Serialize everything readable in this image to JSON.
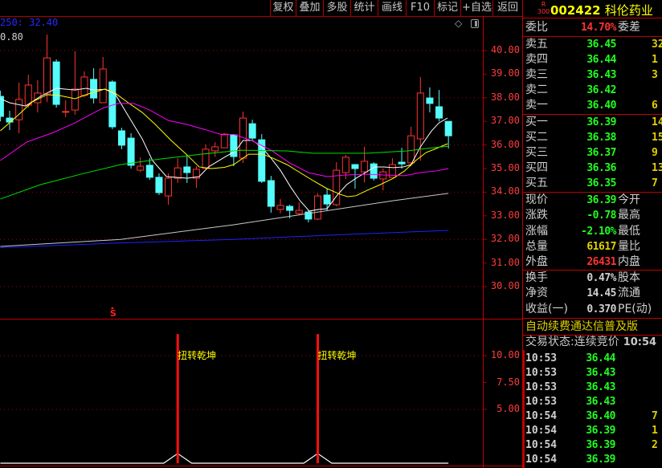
{
  "toolbar": {
    "buttons": [
      "复权",
      "叠加",
      "多股",
      "统计",
      "画线",
      "F10",
      "标记",
      "+自选",
      "返回"
    ]
  },
  "chart_header": {
    "ma_label": "250: 32.40",
    "top_value": "0.80",
    "icons": [
      "diamond-icon",
      "panel-toggle-icon"
    ]
  },
  "colors": {
    "up": "#ff3232",
    "down": "#54fcfc",
    "ma5": "#ffffff",
    "ma10": "#ffff00",
    "ma20": "#ff00ff",
    "ma30": "#00e000",
    "ma60": "#c8c8c8",
    "ma120": "#2020ff",
    "grid": "#a00000",
    "axis_text": "#ff3c3c"
  },
  "chart_data": [
    {
      "type": "candlestick",
      "ylim": [
        30,
        40
      ],
      "y_ticks": [
        "40.00",
        "39.00",
        "38.00",
        "37.00",
        "36.00",
        "35.00",
        "34.00",
        "33.00",
        "32.00",
        "31.00",
        "30.00"
      ],
      "candles": [
        [
          38.06,
          38.3,
          37.0,
          37.21
        ],
        [
          37.14,
          37.45,
          36.63,
          36.97
        ],
        [
          37.07,
          38.64,
          36.5,
          37.93
        ],
        [
          37.69,
          38.98,
          37.58,
          38.54
        ],
        [
          37.79,
          38.74,
          37.38,
          38.2
        ],
        [
          38.16,
          40.68,
          37.82,
          39.69
        ],
        [
          39.52,
          39.63,
          37.58,
          37.72
        ],
        [
          37.4,
          37.89,
          37.18,
          37.42
        ],
        [
          37.48,
          39.97,
          37.28,
          38.37
        ],
        [
          38.1,
          39.12,
          38.03,
          38.88
        ],
        [
          38.78,
          39.25,
          37.76,
          37.99
        ],
        [
          37.79,
          39.73,
          37.79,
          39.22
        ],
        [
          38.67,
          38.74,
          36.67,
          36.77
        ],
        [
          36.6,
          36.73,
          35.82,
          35.99
        ],
        [
          36.29,
          36.5,
          35.0,
          35.14
        ],
        [
          34.93,
          35.48,
          34.86,
          35.1
        ],
        [
          35.14,
          35.44,
          34.52,
          34.63
        ],
        [
          34.63,
          34.8,
          33.88,
          33.98
        ],
        [
          33.84,
          34.8,
          33.47,
          34.59
        ],
        [
          34.59,
          35.44,
          34.39,
          35.03
        ],
        [
          35.07,
          35.58,
          34.39,
          34.83
        ],
        [
          34.59,
          35.1,
          34.18,
          34.97
        ],
        [
          35.0,
          36.02,
          35.0,
          35.82
        ],
        [
          35.75,
          36.12,
          35.5,
          35.92
        ],
        [
          35.88,
          36.5,
          35.88,
          36.46
        ],
        [
          36.43,
          36.46,
          35.1,
          35.51
        ],
        [
          35.44,
          37.41,
          35.24,
          37.14
        ],
        [
          36.9,
          37.07,
          36.22,
          36.29
        ],
        [
          36.22,
          36.46,
          34.39,
          34.46
        ],
        [
          34.49,
          34.69,
          33.13,
          33.4
        ],
        [
          33.27,
          33.71,
          33.1,
          33.44
        ],
        [
          33.4,
          33.47,
          32.89,
          33.23
        ],
        [
          33.1,
          33.57,
          33.03,
          33.23
        ],
        [
          33.16,
          33.23,
          32.72,
          32.86
        ],
        [
          32.86,
          33.95,
          32.82,
          33.84
        ],
        [
          33.88,
          34.15,
          33.2,
          33.5
        ],
        [
          33.47,
          35.27,
          33.4,
          34.93
        ],
        [
          34.83,
          35.58,
          34.56,
          35.48
        ],
        [
          35.17,
          35.17,
          34.15,
          35.0
        ],
        [
          34.86,
          35.92,
          34.42,
          35.31
        ],
        [
          35.2,
          35.27,
          34.49,
          34.59
        ],
        [
          34.56,
          35.0,
          34.08,
          34.86
        ],
        [
          34.63,
          35.44,
          34.63,
          35.17
        ],
        [
          35.27,
          35.88,
          35.0,
          35.2
        ],
        [
          35.24,
          36.77,
          35.1,
          36.39
        ],
        [
          36.26,
          38.88,
          35.34,
          38.2
        ],
        [
          37.99,
          38.44,
          37.38,
          37.76
        ],
        [
          37.62,
          38.33,
          37.0,
          37.14
        ],
        [
          37.0,
          37.0,
          35.85,
          36.39
        ]
      ],
      "ma_lines": [
        {
          "name": "ma5",
          "points": [
            [
              0,
              37.96
            ],
            [
              1,
              37.79
            ],
            [
              2.7,
              37.65
            ],
            [
              4.3,
              38.06
            ],
            [
              6,
              38.4
            ],
            [
              8,
              38.33
            ],
            [
              9.2,
              38.4
            ],
            [
              10,
              38.33
            ],
            [
              11.2,
              38.36
            ],
            [
              12.3,
              38.16
            ],
            [
              14,
              37.04
            ],
            [
              15.2,
              36.26
            ],
            [
              16.3,
              35.34
            ],
            [
              17.8,
              34.66
            ],
            [
              20,
              34.59
            ],
            [
              21.3,
              34.66
            ],
            [
              22.3,
              35.07
            ],
            [
              24,
              35.48
            ],
            [
              25.2,
              35.75
            ],
            [
              26,
              36.19
            ],
            [
              27,
              36.19
            ],
            [
              28,
              35.92
            ],
            [
              29,
              35.44
            ],
            [
              30,
              34.93
            ],
            [
              31.1,
              34.22
            ],
            [
              32.1,
              33.64
            ],
            [
              33.1,
              33.2
            ],
            [
              34.1,
              33.27
            ],
            [
              35,
              33.3
            ],
            [
              36.1,
              33.88
            ],
            [
              37.1,
              34.32
            ],
            [
              38.1,
              34.59
            ],
            [
              39.1,
              34.83
            ],
            [
              40.1,
              35.07
            ],
            [
              41.1,
              35.07
            ],
            [
              42.1,
              35.04
            ],
            [
              43.2,
              35.07
            ],
            [
              44,
              35.17
            ],
            [
              45,
              35.92
            ],
            [
              46.2,
              36.6
            ],
            [
              47,
              36.94
            ],
            [
              47.9,
              37.14
            ]
          ]
        },
        {
          "name": "ma10",
          "points": [
            [
              0,
              36.6
            ],
            [
              1.95,
              37.28
            ],
            [
              3.4,
              37.82
            ],
            [
              5,
              38.13
            ],
            [
              6.3,
              38.1
            ],
            [
              8,
              37.96
            ],
            [
              9.4,
              38.16
            ],
            [
              11.2,
              38.37
            ],
            [
              12.3,
              38.2
            ],
            [
              13.7,
              37.79
            ],
            [
              15.2,
              37.38
            ],
            [
              16.6,
              36.87
            ],
            [
              18.3,
              36.19
            ],
            [
              20,
              35.58
            ],
            [
              21.3,
              35.07
            ],
            [
              22.6,
              35.0
            ],
            [
              24,
              35.05
            ],
            [
              25,
              35.17
            ],
            [
              26.6,
              35.61
            ],
            [
              28.1,
              35.61
            ],
            [
              29.2,
              35.44
            ],
            [
              30.7,
              35.17
            ],
            [
              32.1,
              34.83
            ],
            [
              33.5,
              34.49
            ],
            [
              35,
              34.15
            ],
            [
              36.4,
              33.91
            ],
            [
              37.2,
              33.81
            ],
            [
              38.1,
              33.85
            ],
            [
              39.3,
              34.08
            ],
            [
              40.7,
              34.32
            ],
            [
              42.1,
              34.59
            ],
            [
              43.3,
              34.9
            ],
            [
              44.5,
              35.34
            ],
            [
              45.6,
              35.68
            ],
            [
              46.7,
              35.85
            ],
            [
              47.9,
              36.05
            ]
          ]
        },
        {
          "name": "ma20",
          "points": [
            [
              0,
              35.34
            ],
            [
              2.8,
              36.12
            ],
            [
              5.7,
              36.53
            ],
            [
              8,
              36.94
            ],
            [
              10.9,
              37.55
            ],
            [
              12.6,
              37.76
            ],
            [
              14.3,
              37.76
            ],
            [
              16,
              37.48
            ],
            [
              18,
              37.04
            ],
            [
              20,
              36.87
            ],
            [
              22.1,
              36.63
            ],
            [
              23.8,
              36.43
            ],
            [
              25,
              36.45
            ],
            [
              26.9,
              36.19
            ],
            [
              29,
              35.78
            ],
            [
              31,
              35.24
            ],
            [
              33,
              34.83
            ],
            [
              35,
              34.66
            ],
            [
              37,
              34.73
            ],
            [
              39.3,
              34.76
            ],
            [
              41,
              34.73
            ],
            [
              43.3,
              34.7
            ],
            [
              45,
              34.83
            ],
            [
              46.7,
              34.9
            ],
            [
              48,
              35.0
            ]
          ]
        },
        {
          "name": "ma30",
          "points": [
            [
              0,
              33.71
            ],
            [
              4.3,
              34.32
            ],
            [
              8.6,
              34.76
            ],
            [
              12.9,
              35.17
            ],
            [
              17.2,
              35.41
            ],
            [
              21.5,
              35.61
            ],
            [
              25.8,
              35.78
            ],
            [
              30.7,
              35.75
            ],
            [
              33.5,
              35.65
            ],
            [
              39.3,
              35.65
            ],
            [
              43.6,
              35.75
            ],
            [
              45.6,
              35.85
            ],
            [
              48,
              35.95
            ]
          ]
        },
        {
          "name": "ma60",
          "points": [
            [
              0,
              31.7
            ],
            [
              12.9,
              32.0
            ],
            [
              25,
              32.62
            ],
            [
              30.7,
              32.96
            ],
            [
              36.4,
              33.3
            ],
            [
              42.1,
              33.64
            ],
            [
              48,
              33.95
            ]
          ]
        },
        {
          "name": "ma120",
          "points": [
            [
              0,
              31.65
            ],
            [
              12.9,
              31.85
            ],
            [
              25,
              32.0
            ],
            [
              36.4,
              32.2
            ],
            [
              48,
              32.38
            ]
          ]
        }
      ],
      "markers": [
        {
          "index": 12,
          "label": "S"
        }
      ]
    },
    {
      "type": "bar",
      "ylim": [
        0,
        13.5
      ],
      "y_ticks": [
        "10.00",
        "7.50",
        "5.00"
      ],
      "signals": [
        {
          "index": 19,
          "value": 12,
          "label": "扭转乾坤"
        },
        {
          "index": 34,
          "value": 12,
          "label": "扭转乾坤"
        }
      ],
      "baseline_value": 0,
      "bump_value": 0.9
    }
  ],
  "stock": {
    "badge_top": "R",
    "badge_bottom": "300",
    "code": "002422",
    "name": "科伦药业"
  },
  "weibi": {
    "label": "委比",
    "value": "14.70%",
    "label2": "委差"
  },
  "sell": [
    {
      "label": "卖五",
      "price": "36.45",
      "vol": "32"
    },
    {
      "label": "卖四",
      "price": "36.44",
      "vol": "1"
    },
    {
      "label": "卖三",
      "price": "36.43",
      "vol": "3"
    },
    {
      "label": "卖二",
      "price": "36.42",
      "vol": ""
    },
    {
      "label": "卖一",
      "price": "36.40",
      "vol": "6"
    }
  ],
  "buy": [
    {
      "label": "买一",
      "price": "36.39",
      "vol": "14"
    },
    {
      "label": "买二",
      "price": "36.38",
      "vol": "15"
    },
    {
      "label": "买三",
      "price": "36.37",
      "vol": "9"
    },
    {
      "label": "买四",
      "price": "36.36",
      "vol": "13"
    },
    {
      "label": "买五",
      "price": "36.35",
      "vol": "7"
    }
  ],
  "quote": [
    {
      "label": "现价",
      "value": "36.39",
      "label2": "今开",
      "color": "#20ff20"
    },
    {
      "label": "涨跌",
      "value": "-0.78",
      "label2": "最高",
      "color": "#20ff20"
    },
    {
      "label": "涨幅",
      "value": "-2.10%",
      "label2": "最低",
      "color": "#20ff20"
    },
    {
      "label": "总量",
      "value": "61617",
      "label2": "量比",
      "color": "#e0d000"
    },
    {
      "label": "外盘",
      "value": "26431",
      "label2": "内盘",
      "color": "#ff3232"
    }
  ],
  "fundamentals": [
    {
      "label": "换手",
      "value": "0.47%",
      "label2": "股本"
    },
    {
      "label": "净资",
      "value": "14.45",
      "label2": "流通"
    },
    {
      "label": "收益(一)",
      "value": "0.370",
      "label2": "PE(动)"
    }
  ],
  "banner": "自动续费通达信普及版",
  "status": {
    "label": "交易状态:",
    "value": "连续竞价",
    "time": "10:54"
  },
  "ticks": [
    {
      "time": "10:53",
      "price": "36.44",
      "vol": ""
    },
    {
      "time": "10:53",
      "price": "36.43",
      "vol": ""
    },
    {
      "time": "10:53",
      "price": "36.43",
      "vol": ""
    },
    {
      "time": "10:53",
      "price": "36.43",
      "vol": ""
    },
    {
      "time": "10:54",
      "price": "36.40",
      "vol": "7"
    },
    {
      "time": "10:54",
      "price": "36.39",
      "vol": "1"
    },
    {
      "time": "10:54",
      "price": "36.39",
      "vol": "2"
    },
    {
      "time": "10:54",
      "price": "36.39",
      "vol": ""
    }
  ]
}
